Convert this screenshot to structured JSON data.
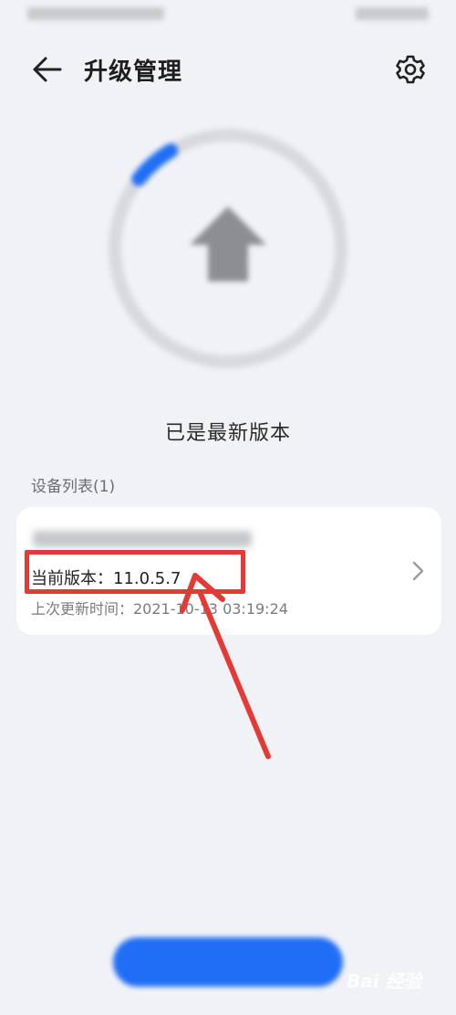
{
  "header": {
    "title": "升级管理"
  },
  "status": {
    "message": "已是最新版本"
  },
  "device_list": {
    "label": "设备列表(1)",
    "items": [
      {
        "current_version": "当前版本：11.0.5.7",
        "last_update": "上次更新时间：2021-10-13 03:19:24"
      }
    ]
  },
  "update_progress": 0.06,
  "colors": {
    "background": "#f1f2f6",
    "accent": "#1f6ef5",
    "annotation": "#e53935",
    "ring": "#d8d9de"
  },
  "icons": {
    "back": "back-arrow-icon",
    "settings": "gear-icon",
    "upgrade": "upload-arrow-icon",
    "chevron": "chevron-right-icon"
  },
  "watermark": {
    "text": "Bai 经验"
  }
}
